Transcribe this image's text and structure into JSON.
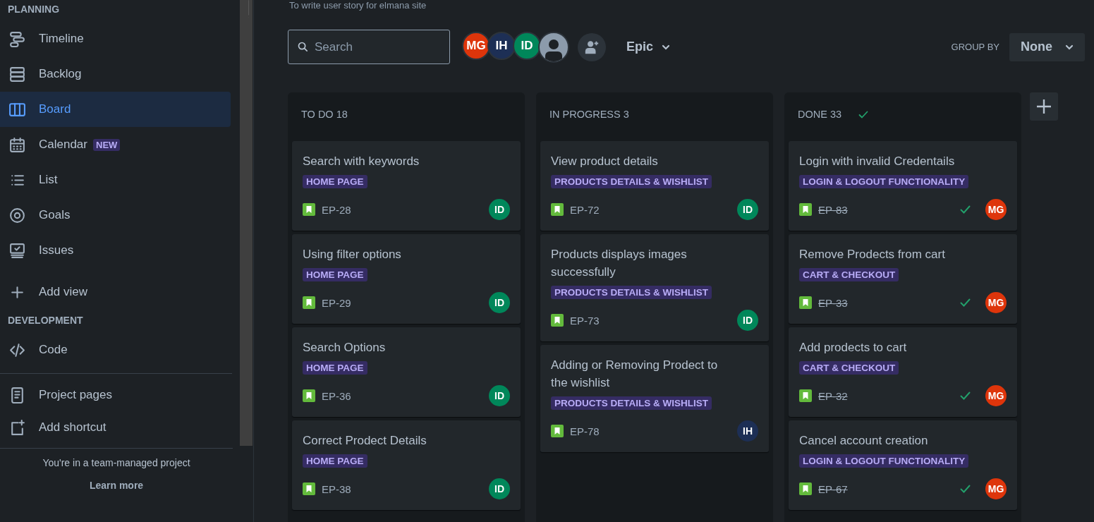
{
  "project": {
    "subtitle": "To write user story for elmana site"
  },
  "sidebar": {
    "sections": [
      {
        "heading": "PLANNING",
        "items": [
          {
            "label": "Timeline",
            "selected": false
          },
          {
            "label": "Backlog",
            "selected": false
          },
          {
            "label": "Board",
            "selected": true
          },
          {
            "label": "Calendar",
            "selected": false,
            "badge": "NEW"
          },
          {
            "label": "List",
            "selected": false
          },
          {
            "label": "Goals",
            "selected": false
          },
          {
            "label": "Issues",
            "selected": false
          },
          {
            "label": "Add view",
            "selected": false
          }
        ]
      },
      {
        "heading": "DEVELOPMENT",
        "items": [
          {
            "label": "Code",
            "selected": false
          }
        ]
      }
    ],
    "shortcuts": [
      "Project pages",
      "Add shortcut"
    ],
    "footer": {
      "text": "You're in a team-managed project",
      "link": "Learn more"
    }
  },
  "toolbar": {
    "search": {
      "placeholder": "Search"
    },
    "people": [
      {
        "kind": "initials",
        "initials": "MG",
        "color": "#de350b"
      },
      {
        "kind": "initials",
        "initials": "IH",
        "color": "#1d2f55"
      },
      {
        "kind": "initials",
        "initials": "ID",
        "color": "#00875a"
      },
      {
        "kind": "silhouette"
      }
    ],
    "filter": "Epic",
    "group_by": {
      "label": "GROUP BY",
      "value": "None"
    }
  },
  "columns": [
    {
      "title": "TO DO 18",
      "complete": false,
      "cards": [
        {
          "title": "Search with keywords",
          "epic": "HOME PAGE",
          "key": "EP-28",
          "done": false,
          "assignee": {
            "initials": "ID",
            "color": "#00875a"
          }
        },
        {
          "title": "Using filter options",
          "epic": "HOME PAGE",
          "key": "EP-29",
          "done": false,
          "assignee": {
            "initials": "ID",
            "color": "#00875a"
          }
        },
        {
          "title": "Search Options",
          "epic": "HOME PAGE",
          "key": "EP-36",
          "done": false,
          "assignee": {
            "initials": "ID",
            "color": "#00875a"
          }
        },
        {
          "title": "Correct Prodect Details",
          "epic": "HOME PAGE",
          "key": "EP-38",
          "done": false,
          "assignee": {
            "initials": "ID",
            "color": "#00875a"
          }
        }
      ]
    },
    {
      "title": "IN PROGRESS 3",
      "complete": false,
      "cards": [
        {
          "title": "View product details",
          "epic": "PRODUCTS DETAILS & WISHLIST",
          "key": "EP-72",
          "done": false,
          "assignee": {
            "initials": "ID",
            "color": "#00875a"
          }
        },
        {
          "title": "Products displays images successfully",
          "epic": "PRODUCTS DETAILS & WISHLIST",
          "key": "EP-73",
          "done": false,
          "assignee": {
            "initials": "ID",
            "color": "#00875a"
          }
        },
        {
          "title": "Adding or Removing Prodect to the wishlist",
          "epic": "PRODUCTS DETAILS & WISHLIST",
          "key": "EP-78",
          "done": false,
          "assignee": {
            "initials": "IH",
            "color": "#1d2f55"
          }
        }
      ]
    },
    {
      "title": "DONE 33",
      "complete": true,
      "cards": [
        {
          "title": "Login with invalid Credentails",
          "epic": "LOGIN & LOGOUT FUNCTIONALITY",
          "key": "EP-83",
          "done": true,
          "assignee": {
            "initials": "MG",
            "color": "#de350b"
          }
        },
        {
          "title": "Remove Prodects from cart",
          "epic": "CART & CHECKOUT",
          "key": "EP-33",
          "done": true,
          "assignee": {
            "initials": "MG",
            "color": "#de350b"
          }
        },
        {
          "title": "Add prodects to cart",
          "epic": "CART & CHECKOUT",
          "key": "EP-32",
          "done": true,
          "assignee": {
            "initials": "MG",
            "color": "#de350b"
          }
        },
        {
          "title": "Cancel account creation",
          "epic": "LOGIN & LOGOUT FUNCTIONALITY",
          "key": "EP-67",
          "done": true,
          "assignee": {
            "initials": "MG",
            "color": "#de350b"
          }
        }
      ]
    }
  ]
}
